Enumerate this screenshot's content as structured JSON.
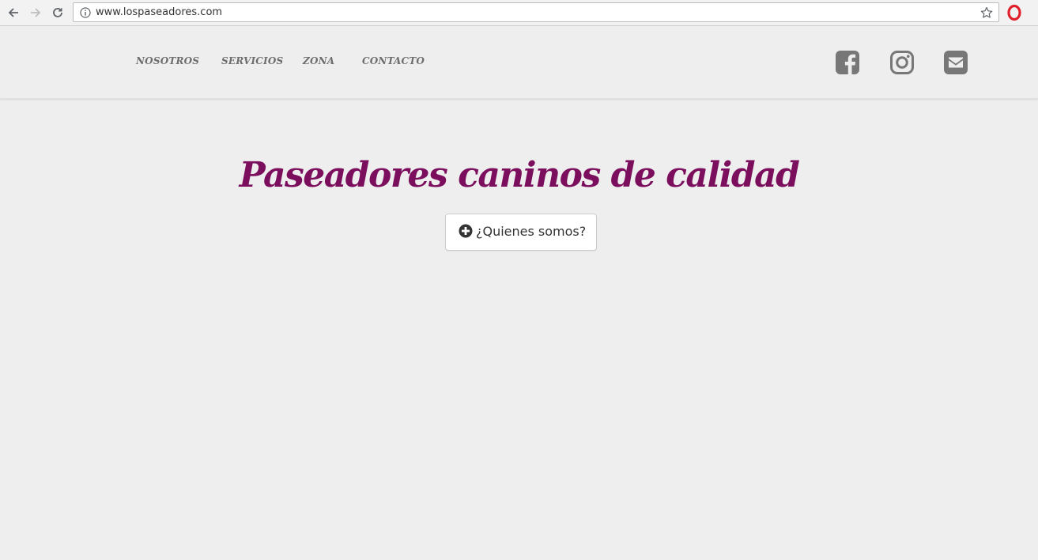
{
  "browser": {
    "url": "www.lospaseadores.com"
  },
  "header": {
    "menu": [
      {
        "label": "NOSOTROS"
      },
      {
        "label": "SERVICIOS"
      },
      {
        "label": "ZONA"
      },
      {
        "label": "CONTACTO"
      }
    ],
    "social": [
      {
        "icon": "facebook-icon"
      },
      {
        "icon": "instagram-icon"
      },
      {
        "icon": "envelope-icon"
      }
    ]
  },
  "hero": {
    "title": "Paseadores caninos de calidad",
    "button_label": "¿Quienes somos?",
    "button_icon": "plus-circle-icon"
  },
  "colors": {
    "background": "#eeeeee",
    "title": "#7b0f5d",
    "menu_text": "#6d6d6d",
    "icon_gray": "#777777",
    "opera_red": "#e0202a"
  }
}
